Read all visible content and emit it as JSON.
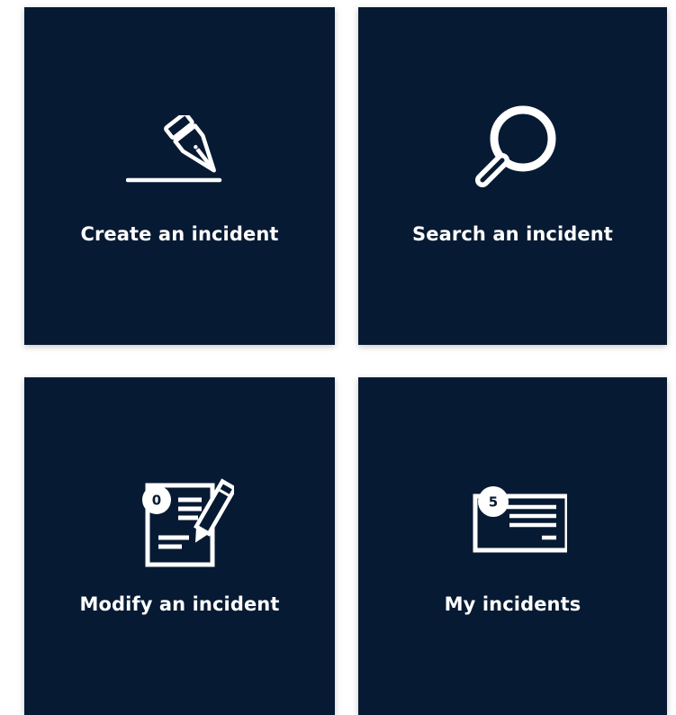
{
  "colors": {
    "tile_background": "#071a33",
    "icon_color": "#ffffff",
    "page_background": "#ffffff"
  },
  "tiles": [
    {
      "label": "Create an incident",
      "icon": "pen-nib-icon"
    },
    {
      "label": "Search an incident",
      "icon": "magnifier-icon"
    },
    {
      "label": "Modify an incident",
      "icon": "edit-document-icon",
      "badge": "0"
    },
    {
      "label": "My incidents",
      "icon": "ticket-list-icon",
      "badge": "5"
    }
  ]
}
